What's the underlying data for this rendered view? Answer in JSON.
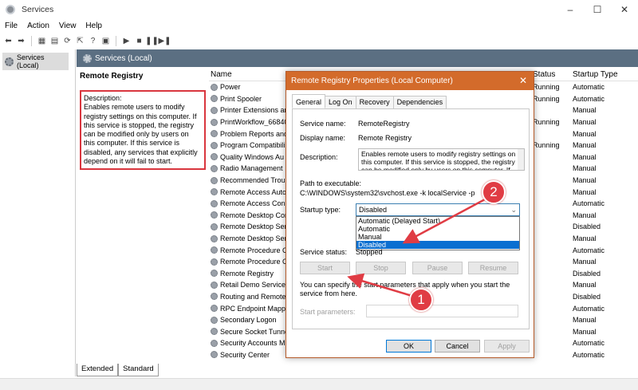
{
  "window": {
    "title": "Services",
    "minimize": "–",
    "maximize": "☐",
    "close": "✕"
  },
  "menu": [
    "File",
    "Action",
    "View",
    "Help"
  ],
  "tree": {
    "label": "Services (Local)"
  },
  "header": {
    "title": "Services (Local)"
  },
  "description_panel": {
    "service_title": "Remote Registry",
    "description_label": "Description:",
    "description_text": "Enables remote users to modify registry settings on this computer. If this service is stopped, the registry can be modified only by users on this computer. If this service is disabled, any services that explicitly depend on it will fail to start."
  },
  "columns": {
    "name": "Name",
    "status": "Status",
    "startup": "Startup Type"
  },
  "services": [
    {
      "name": "Power",
      "status": "Running",
      "startup": "Automatic"
    },
    {
      "name": "Print Spooler",
      "status": "Running",
      "startup": "Automatic"
    },
    {
      "name": "Printer Extensions an",
      "status": "",
      "startup": "Manual"
    },
    {
      "name": "PrintWorkflow_66840",
      "status": "Running",
      "startup": "Manual"
    },
    {
      "name": "Problem Reports and",
      "status": "",
      "startup": "Manual"
    },
    {
      "name": "Program Compatibili",
      "status": "Running",
      "startup": "Manual"
    },
    {
      "name": "Quality Windows Au",
      "status": "",
      "startup": "Manual"
    },
    {
      "name": "Radio Management",
      "status": "",
      "startup": "Manual"
    },
    {
      "name": "Recommended Troubl",
      "status": "",
      "startup": "Manual"
    },
    {
      "name": "Remote Access Auto",
      "status": "",
      "startup": "Manual"
    },
    {
      "name": "Remote Access Conn",
      "status": "",
      "startup": "Automatic"
    },
    {
      "name": "Remote Desktop Con",
      "status": "",
      "startup": "Manual"
    },
    {
      "name": "Remote Desktop Ser",
      "status": "",
      "startup": "Disabled"
    },
    {
      "name": "Remote Desktop Ser",
      "status": "",
      "startup": "Manual"
    },
    {
      "name": "Remote Procedure C",
      "status": "",
      "startup": "Automatic"
    },
    {
      "name": "Remote Procedure C",
      "status": "",
      "startup": "Manual"
    },
    {
      "name": "Remote Registry",
      "status": "",
      "startup": "Disabled"
    },
    {
      "name": "Retail Demo Service",
      "status": "",
      "startup": "Manual"
    },
    {
      "name": "Routing and Remote",
      "status": "",
      "startup": "Disabled"
    },
    {
      "name": "RPC Endpoint Mapp",
      "status": "",
      "startup": "Automatic"
    },
    {
      "name": "Secondary Logon",
      "status": "",
      "startup": "Manual"
    },
    {
      "name": "Secure Socket Tunne",
      "status": "",
      "startup": "Manual"
    },
    {
      "name": "Security Accounts M",
      "status": "",
      "startup": "Automatic"
    },
    {
      "name": "Security Center",
      "status": "",
      "startup": "Automatic"
    }
  ],
  "bottom_tabs": [
    "Extended",
    "Standard"
  ],
  "dialog": {
    "title": "Remote Registry Properties (Local Computer)",
    "close": "✕",
    "tabs": [
      "General",
      "Log On",
      "Recovery",
      "Dependencies"
    ],
    "service_name_label": "Service name:",
    "service_name": "RemoteRegistry",
    "display_name_label": "Display name:",
    "display_name": "Remote Registry",
    "description_label": "Description:",
    "description": "Enables remote users to modify registry settings on this computer. If this service is stopped, the registry can be modified only by users on this computer. If",
    "path_label": "Path to executable:",
    "path": "C:\\WINDOWS\\system32\\svchost.exe -k localService -p",
    "startup_type_label": "Startup type:",
    "startup_type_value": "Disabled",
    "startup_options": [
      "Automatic (Delayed Start)",
      "Automatic",
      "Manual",
      "Disabled"
    ],
    "service_status_label": "Service status:",
    "service_status": "Stopped",
    "buttons": {
      "start": "Start",
      "stop": "Stop",
      "pause": "Pause",
      "resume": "Resume"
    },
    "help_text": "You can specify the start parameters that apply when you start the service from here.",
    "start_params_label": "Start parameters:",
    "ok": "OK",
    "cancel": "Cancel",
    "apply": "Apply"
  },
  "callouts": {
    "one": "1",
    "two": "2"
  },
  "colors": {
    "accent": "#d36b2b",
    "callout": "#e03c44",
    "selection": "#0b6fd1"
  }
}
